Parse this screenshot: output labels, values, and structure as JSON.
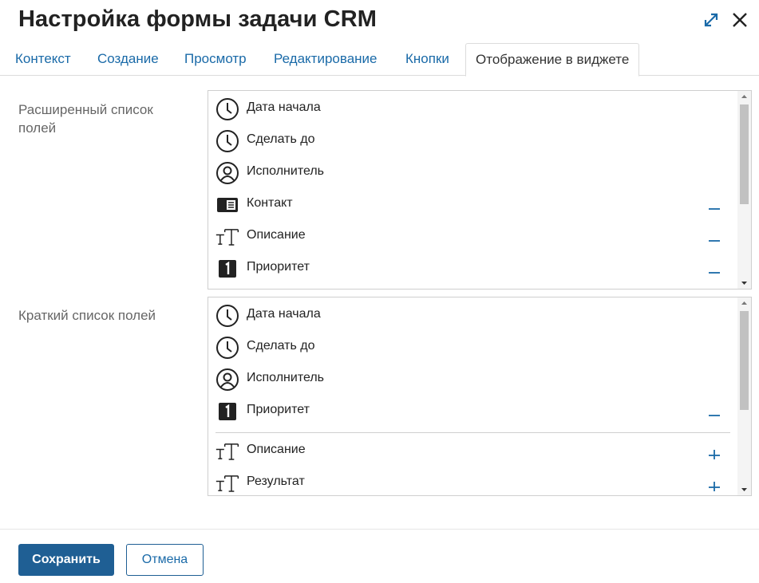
{
  "dialog": {
    "title": "Настройка формы задачи CRM",
    "expand_icon": "expand-arrows-icon",
    "close_icon": "close-icon"
  },
  "tabs": [
    {
      "label": "Контекст",
      "active": false
    },
    {
      "label": "Создание",
      "active": false
    },
    {
      "label": "Просмотр",
      "active": false
    },
    {
      "label": "Редактирование",
      "active": false
    },
    {
      "label": "Кнопки",
      "active": false
    },
    {
      "label": "Отображение в виджете",
      "active": true
    }
  ],
  "extended_list": {
    "label": "Расширенный список полей",
    "items": [
      {
        "label": "Дата начала",
        "icon": "clock-icon",
        "action": ""
      },
      {
        "label": "Сделать до",
        "icon": "clock-icon",
        "action": ""
      },
      {
        "label": "Исполнитель",
        "icon": "user-icon",
        "action": ""
      },
      {
        "label": "Контакт",
        "icon": "contact-card-icon",
        "action": "remove"
      },
      {
        "label": "Описание",
        "icon": "text-icon",
        "action": "remove"
      },
      {
        "label": "Приоритет",
        "icon": "number-icon",
        "action": "remove"
      }
    ]
  },
  "short_list": {
    "label": "Краткий список полей",
    "items": [
      {
        "label": "Дата начала",
        "icon": "clock-icon",
        "action": ""
      },
      {
        "label": "Сделать до",
        "icon": "clock-icon",
        "action": ""
      },
      {
        "label": "Исполнитель",
        "icon": "user-icon",
        "action": ""
      },
      {
        "label": "Приоритет",
        "icon": "number-icon",
        "action": "remove"
      }
    ],
    "available_items": [
      {
        "label": "Описание",
        "icon": "text-icon",
        "action": "add"
      },
      {
        "label": "Результат",
        "icon": "text-icon",
        "action": "add"
      }
    ]
  },
  "footer": {
    "save_label": "Сохранить",
    "cancel_label": "Отмена"
  },
  "colors": {
    "accent": "#1f5f94",
    "link": "#1a6aa8"
  }
}
